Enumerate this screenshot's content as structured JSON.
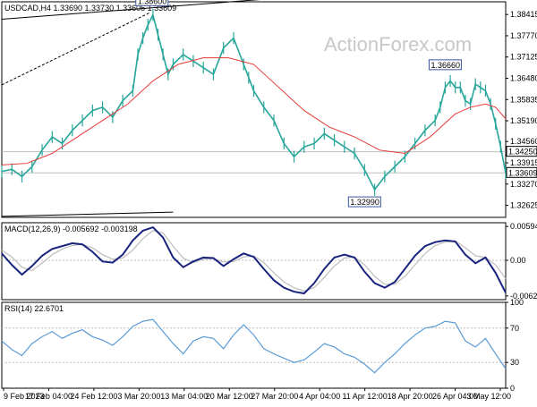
{
  "watermark": "ActionForex.com",
  "colors": {
    "bull": "#26a69a",
    "ma": "#e53935",
    "trend": "#000000",
    "grid": "#bdbdbd",
    "macd": "#1a237e",
    "signal": "#bdbdbd",
    "rsi": "#5b9bd5",
    "callout": "#3a55a0"
  },
  "chart_data": [
    {
      "type": "candlestick",
      "title": "USDCAD,H4  1.33690 1.33730 1.33605 1.33609",
      "ylim": [
        1.3226,
        1.388
      ],
      "yticks": [
        "1.38415",
        "1.37770",
        "1.37125",
        "1.36480",
        "1.35835",
        "1.35190",
        "1.34560",
        "1.33915",
        "1.33270",
        "1.32625"
      ],
      "ytick_values": [
        1.38415,
        1.3777,
        1.37125,
        1.3648,
        1.35835,
        1.3519,
        1.3456,
        1.33915,
        1.3327,
        1.32625
      ],
      "hlines": [
        1.3425,
        1.33609
      ],
      "price_labels": [
        {
          "text": "1.34250",
          "value": 1.3425
        },
        {
          "text": "1.33609",
          "value": 1.33609,
          "current": true
        }
      ],
      "callouts": [
        {
          "text": "1.38600",
          "x": 0.298,
          "value": 1.386
        },
        {
          "text": "1.36660",
          "x": 0.88,
          "value": 1.3666
        },
        {
          "text": "1.32990",
          "x": 0.72,
          "value": 1.3299
        }
      ],
      "trendlines": [
        {
          "x": [
            0.0,
            0.6
          ],
          "y": [
            1.3827,
            1.3897
          ]
        },
        {
          "x": [
            0.0,
            0.295
          ],
          "y": [
            1.3628,
            1.3848
          ],
          "dashed": true
        },
        {
          "x": [
            0.0,
            0.34
          ],
          "y": [
            1.3229,
            1.3242
          ]
        }
      ],
      "close_x": [
        0.0,
        0.02,
        0.04,
        0.06,
        0.08,
        0.1,
        0.12,
        0.14,
        0.16,
        0.18,
        0.2,
        0.22,
        0.24,
        0.26,
        0.27,
        0.28,
        0.29,
        0.3,
        0.31,
        0.32,
        0.33,
        0.34,
        0.36,
        0.38,
        0.4,
        0.42,
        0.44,
        0.46,
        0.48,
        0.49,
        0.5,
        0.52,
        0.54,
        0.56,
        0.58,
        0.6,
        0.62,
        0.64,
        0.66,
        0.68,
        0.7,
        0.72,
        0.74,
        0.76,
        0.78,
        0.8,
        0.82,
        0.84,
        0.86,
        0.87,
        0.88,
        0.89,
        0.9,
        0.91,
        0.92,
        0.93,
        0.94,
        0.95,
        0.96,
        0.97,
        0.98,
        0.99,
        1.0
      ],
      "close_y": [
        1.3365,
        1.3372,
        1.335,
        1.338,
        1.343,
        1.347,
        1.345,
        1.349,
        1.352,
        1.355,
        1.356,
        1.353,
        1.358,
        1.361,
        1.372,
        1.377,
        1.381,
        1.384,
        1.378,
        1.372,
        1.366,
        1.369,
        1.372,
        1.37,
        1.368,
        1.366,
        1.374,
        1.377,
        1.369,
        1.365,
        1.361,
        1.356,
        1.352,
        1.345,
        1.341,
        1.344,
        1.345,
        1.348,
        1.346,
        1.344,
        1.342,
        1.337,
        1.331,
        1.335,
        1.338,
        1.341,
        1.345,
        1.349,
        1.352,
        1.356,
        1.362,
        1.364,
        1.362,
        1.362,
        1.358,
        1.357,
        1.363,
        1.362,
        1.361,
        1.357,
        1.351,
        1.344,
        1.3361
      ],
      "ma_x": [
        0.0,
        0.05,
        0.1,
        0.15,
        0.2,
        0.25,
        0.3,
        0.35,
        0.4,
        0.45,
        0.5,
        0.55,
        0.6,
        0.65,
        0.7,
        0.75,
        0.8,
        0.85,
        0.9,
        0.93,
        0.96,
        0.98,
        1.0
      ],
      "ma_y": [
        1.3385,
        1.339,
        1.342,
        1.347,
        1.352,
        1.357,
        1.364,
        1.369,
        1.371,
        1.371,
        1.369,
        1.362,
        1.355,
        1.35,
        1.347,
        1.343,
        1.342,
        1.347,
        1.354,
        1.356,
        1.357,
        1.356,
        1.3525
      ]
    },
    {
      "type": "line",
      "title": "MACD(12,26,9) -0.005692 -0.003198",
      "ylim": [
        -0.0069,
        0.0066
      ],
      "yticks": [
        "0.005941",
        "0.00",
        "-0.006246"
      ],
      "ytick_values": [
        0.005941,
        0.0,
        -0.006246
      ],
      "x": [
        0.0,
        0.02,
        0.04,
        0.06,
        0.08,
        0.1,
        0.12,
        0.14,
        0.16,
        0.18,
        0.2,
        0.22,
        0.24,
        0.26,
        0.28,
        0.3,
        0.32,
        0.34,
        0.36,
        0.38,
        0.4,
        0.42,
        0.44,
        0.46,
        0.48,
        0.5,
        0.52,
        0.54,
        0.56,
        0.58,
        0.6,
        0.62,
        0.64,
        0.66,
        0.68,
        0.7,
        0.72,
        0.74,
        0.76,
        0.78,
        0.8,
        0.82,
        0.84,
        0.86,
        0.88,
        0.9,
        0.92,
        0.94,
        0.96,
        0.98,
        1.0
      ],
      "series": [
        {
          "values": [
            0.0012,
            -0.0008,
            -0.0025,
            -0.001,
            0.0008,
            0.002,
            0.0025,
            0.003,
            0.0028,
            0.0015,
            -0.0002,
            -0.0004,
            0.001,
            0.0035,
            0.0052,
            0.0058,
            0.004,
            0.0005,
            -0.0012,
            -0.0002,
            0.0005,
            0.0004,
            -0.001,
            0.0002,
            0.0012,
            0.0006,
            -0.0015,
            -0.0035,
            -0.0048,
            -0.0055,
            -0.0058,
            -0.004,
            -0.0015,
            0.0005,
            0.001,
            0.0005,
            -0.002,
            -0.004,
            -0.0048,
            -0.0038,
            -0.0015,
            0.0008,
            0.0025,
            0.0032,
            0.0035,
            0.0033,
            0.001,
            -0.0005,
            0.0005,
            -0.0022,
            -0.0057
          ]
        },
        {
          "values": [
            0.0018,
            0.0006,
            -0.0012,
            -0.0018,
            -0.0005,
            0.001,
            0.002,
            0.0026,
            0.0028,
            0.0022,
            0.001,
            0.0002,
            0.0004,
            0.0018,
            0.0038,
            0.0052,
            0.0048,
            0.0025,
            0.0004,
            -0.0004,
            0.0002,
            0.0003,
            -0.0003,
            -0.0002,
            0.0006,
            0.0008,
            -0.0004,
            -0.0022,
            -0.0038,
            -0.0048,
            -0.0054,
            -0.0048,
            -0.003,
            -0.001,
            0.0004,
            0.0006,
            -0.0008,
            -0.0028,
            -0.0042,
            -0.0042,
            -0.0028,
            -0.0008,
            0.0012,
            0.0026,
            0.0032,
            0.0034,
            0.0022,
            0.0008,
            0.0005,
            -0.0008,
            -0.0032
          ]
        }
      ]
    },
    {
      "type": "line",
      "title": "RSI(14) 22.6701",
      "ylim": [
        0,
        100
      ],
      "yticks": [
        "100",
        "70",
        "30",
        "0"
      ],
      "ytick_values": [
        100,
        70,
        30,
        0
      ],
      "hlines": [
        70,
        30
      ],
      "x": [
        0.0,
        0.02,
        0.04,
        0.06,
        0.08,
        0.1,
        0.12,
        0.14,
        0.16,
        0.18,
        0.2,
        0.22,
        0.24,
        0.26,
        0.28,
        0.3,
        0.32,
        0.34,
        0.36,
        0.38,
        0.4,
        0.42,
        0.44,
        0.46,
        0.48,
        0.5,
        0.52,
        0.54,
        0.56,
        0.58,
        0.6,
        0.62,
        0.64,
        0.66,
        0.68,
        0.7,
        0.72,
        0.74,
        0.76,
        0.78,
        0.8,
        0.82,
        0.84,
        0.86,
        0.88,
        0.9,
        0.92,
        0.94,
        0.96,
        0.98,
        1.0
      ],
      "values": [
        55,
        45,
        38,
        52,
        60,
        66,
        58,
        64,
        68,
        60,
        56,
        50,
        60,
        72,
        78,
        80,
        66,
        52,
        40,
        55,
        60,
        58,
        46,
        62,
        74,
        62,
        46,
        40,
        35,
        30,
        33,
        42,
        52,
        48,
        40,
        36,
        28,
        18,
        30,
        40,
        52,
        62,
        70,
        72,
        78,
        76,
        55,
        48,
        58,
        40,
        22.67
      ]
    }
  ],
  "x_labels": [
    "9 Feb 2023",
    "17 Feb 04:00",
    "24 Feb 12:00",
    "3 Mar 20:00",
    "13 Mar 04:00",
    "20 Mar 12:00",
    "27 Mar 20:00",
    "4 Apr 04:00",
    "11 Apr 12:00",
    "18 Apr 20:00",
    "26 Apr 04:00",
    "3 May 12:00"
  ]
}
